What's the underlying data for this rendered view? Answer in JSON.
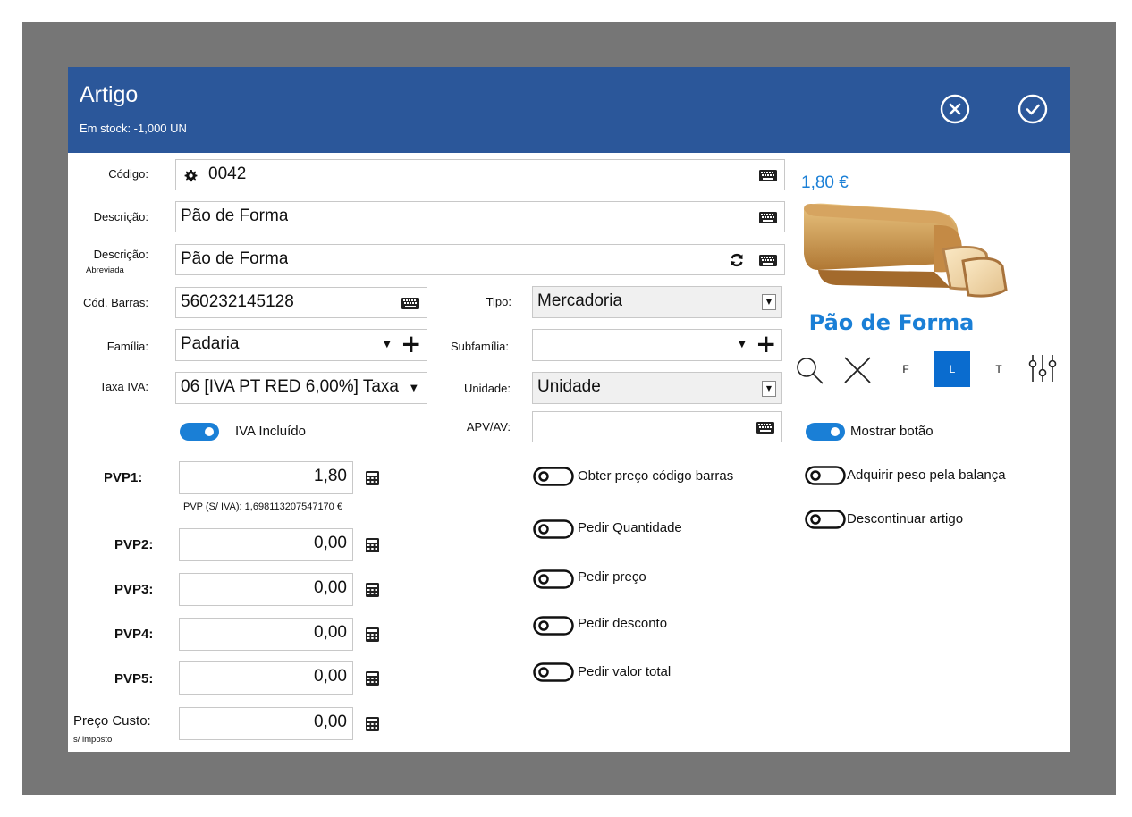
{
  "header": {
    "title": "Artigo",
    "stock": "Em stock: -1,000 UN"
  },
  "labels": {
    "codigo": "Código:",
    "descricao": "Descrição:",
    "descricao_abrev": "Descrição:",
    "abreviada": "Abreviada",
    "cod_barras": "Cód. Barras:",
    "tipo": "Tipo:",
    "familia": "Família:",
    "subfamilia": "Subfamília:",
    "taxa_iva": "Taxa IVA:",
    "unidade": "Unidade:",
    "apv": "APV/AV:",
    "pvp1": "PVP1:",
    "pvp2": "PVP2:",
    "pvp3": "PVP3:",
    "pvp4": "PVP4:",
    "pvp5": "PVP5:",
    "preco_custo": "Preço Custo:",
    "s_imposto": "s/ imposto"
  },
  "fields": {
    "codigo": "0042",
    "descricao": "Pão de Forma",
    "descricao_abrev": "Pão de Forma",
    "cod_barras": "560232145128",
    "tipo": "Mercadoria",
    "familia": "Padaria",
    "subfamilia": "",
    "taxa_iva": "06 [IVA PT RED 6,00%] Taxa",
    "unidade": "Unidade",
    "apv": "",
    "pvp1": "1,80",
    "pvp1_sem_iva": "PVP (S/ IVA): 1,698113207547170 €",
    "pvp2": "0,00",
    "pvp3": "0,00",
    "pvp4": "0,00",
    "pvp5": "0,00",
    "preco_custo": "0,00"
  },
  "toggles": {
    "iva_incluido": "IVA Incluído",
    "obter_preco": "Obter preço código barras",
    "pedir_quantidade": "Pedir Quantidade",
    "pedir_preco": "Pedir preço",
    "pedir_desconto": "Pedir desconto",
    "pedir_valor_total": "Pedir valor total",
    "mostrar_botao": "Mostrar botão",
    "adquirir_peso": "Adquirir peso pela balança",
    "descontinuar": "Descontinuar artigo"
  },
  "toggle_states": {
    "iva_incluido": true,
    "mostrar_botao": true,
    "obter_preco": false,
    "pedir_quantidade": false,
    "pedir_preco": false,
    "pedir_desconto": false,
    "pedir_valor_total": false,
    "adquirir_peso": false,
    "descontinuar": false
  },
  "preview": {
    "price": "1,80 €",
    "name": "Pão de Forma",
    "align_f": "F",
    "align_l": "L",
    "align_t": "T"
  },
  "colors": {
    "header": "#2b579a",
    "accent": "#1a7fd6",
    "selected_align": "#0a6ccf"
  }
}
